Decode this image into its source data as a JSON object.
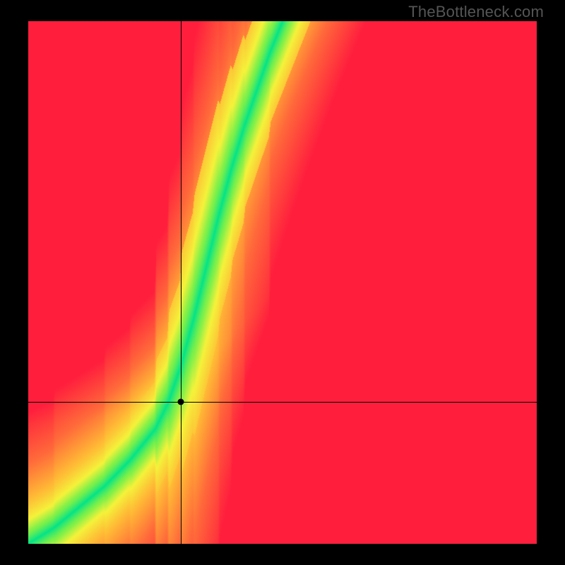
{
  "watermark": "TheBottleneck.com",
  "chart_data": {
    "type": "heatmap",
    "title": "",
    "xlabel": "",
    "ylabel": "",
    "xlim": [
      0,
      1
    ],
    "ylim": [
      0,
      1
    ],
    "grid": false,
    "legend": false,
    "ridge_points": [
      {
        "x": 0.0,
        "y": 0.0
      },
      {
        "x": 0.05,
        "y": 0.03
      },
      {
        "x": 0.1,
        "y": 0.07
      },
      {
        "x": 0.15,
        "y": 0.11
      },
      {
        "x": 0.2,
        "y": 0.16
      },
      {
        "x": 0.25,
        "y": 0.22
      },
      {
        "x": 0.275,
        "y": 0.27
      },
      {
        "x": 0.3,
        "y": 0.34
      },
      {
        "x": 0.325,
        "y": 0.43
      },
      {
        "x": 0.35,
        "y": 0.53
      },
      {
        "x": 0.375,
        "y": 0.63
      },
      {
        "x": 0.4,
        "y": 0.72
      },
      {
        "x": 0.425,
        "y": 0.8
      },
      {
        "x": 0.45,
        "y": 0.87
      },
      {
        "x": 0.475,
        "y": 0.94
      },
      {
        "x": 0.5,
        "y": 1.0
      }
    ],
    "ridge_half_width_x": 0.04,
    "color_stops": [
      {
        "t": 0.0,
        "color": "#00e38a"
      },
      {
        "t": 0.1,
        "color": "#7bf04a"
      },
      {
        "t": 0.22,
        "color": "#f5f23a"
      },
      {
        "t": 0.4,
        "color": "#ffb735"
      },
      {
        "t": 0.65,
        "color": "#ff6a3a"
      },
      {
        "t": 1.0,
        "color": "#ff1f3d"
      }
    ],
    "marker": {
      "x": 0.3,
      "y": 0.27
    },
    "annotations": []
  }
}
